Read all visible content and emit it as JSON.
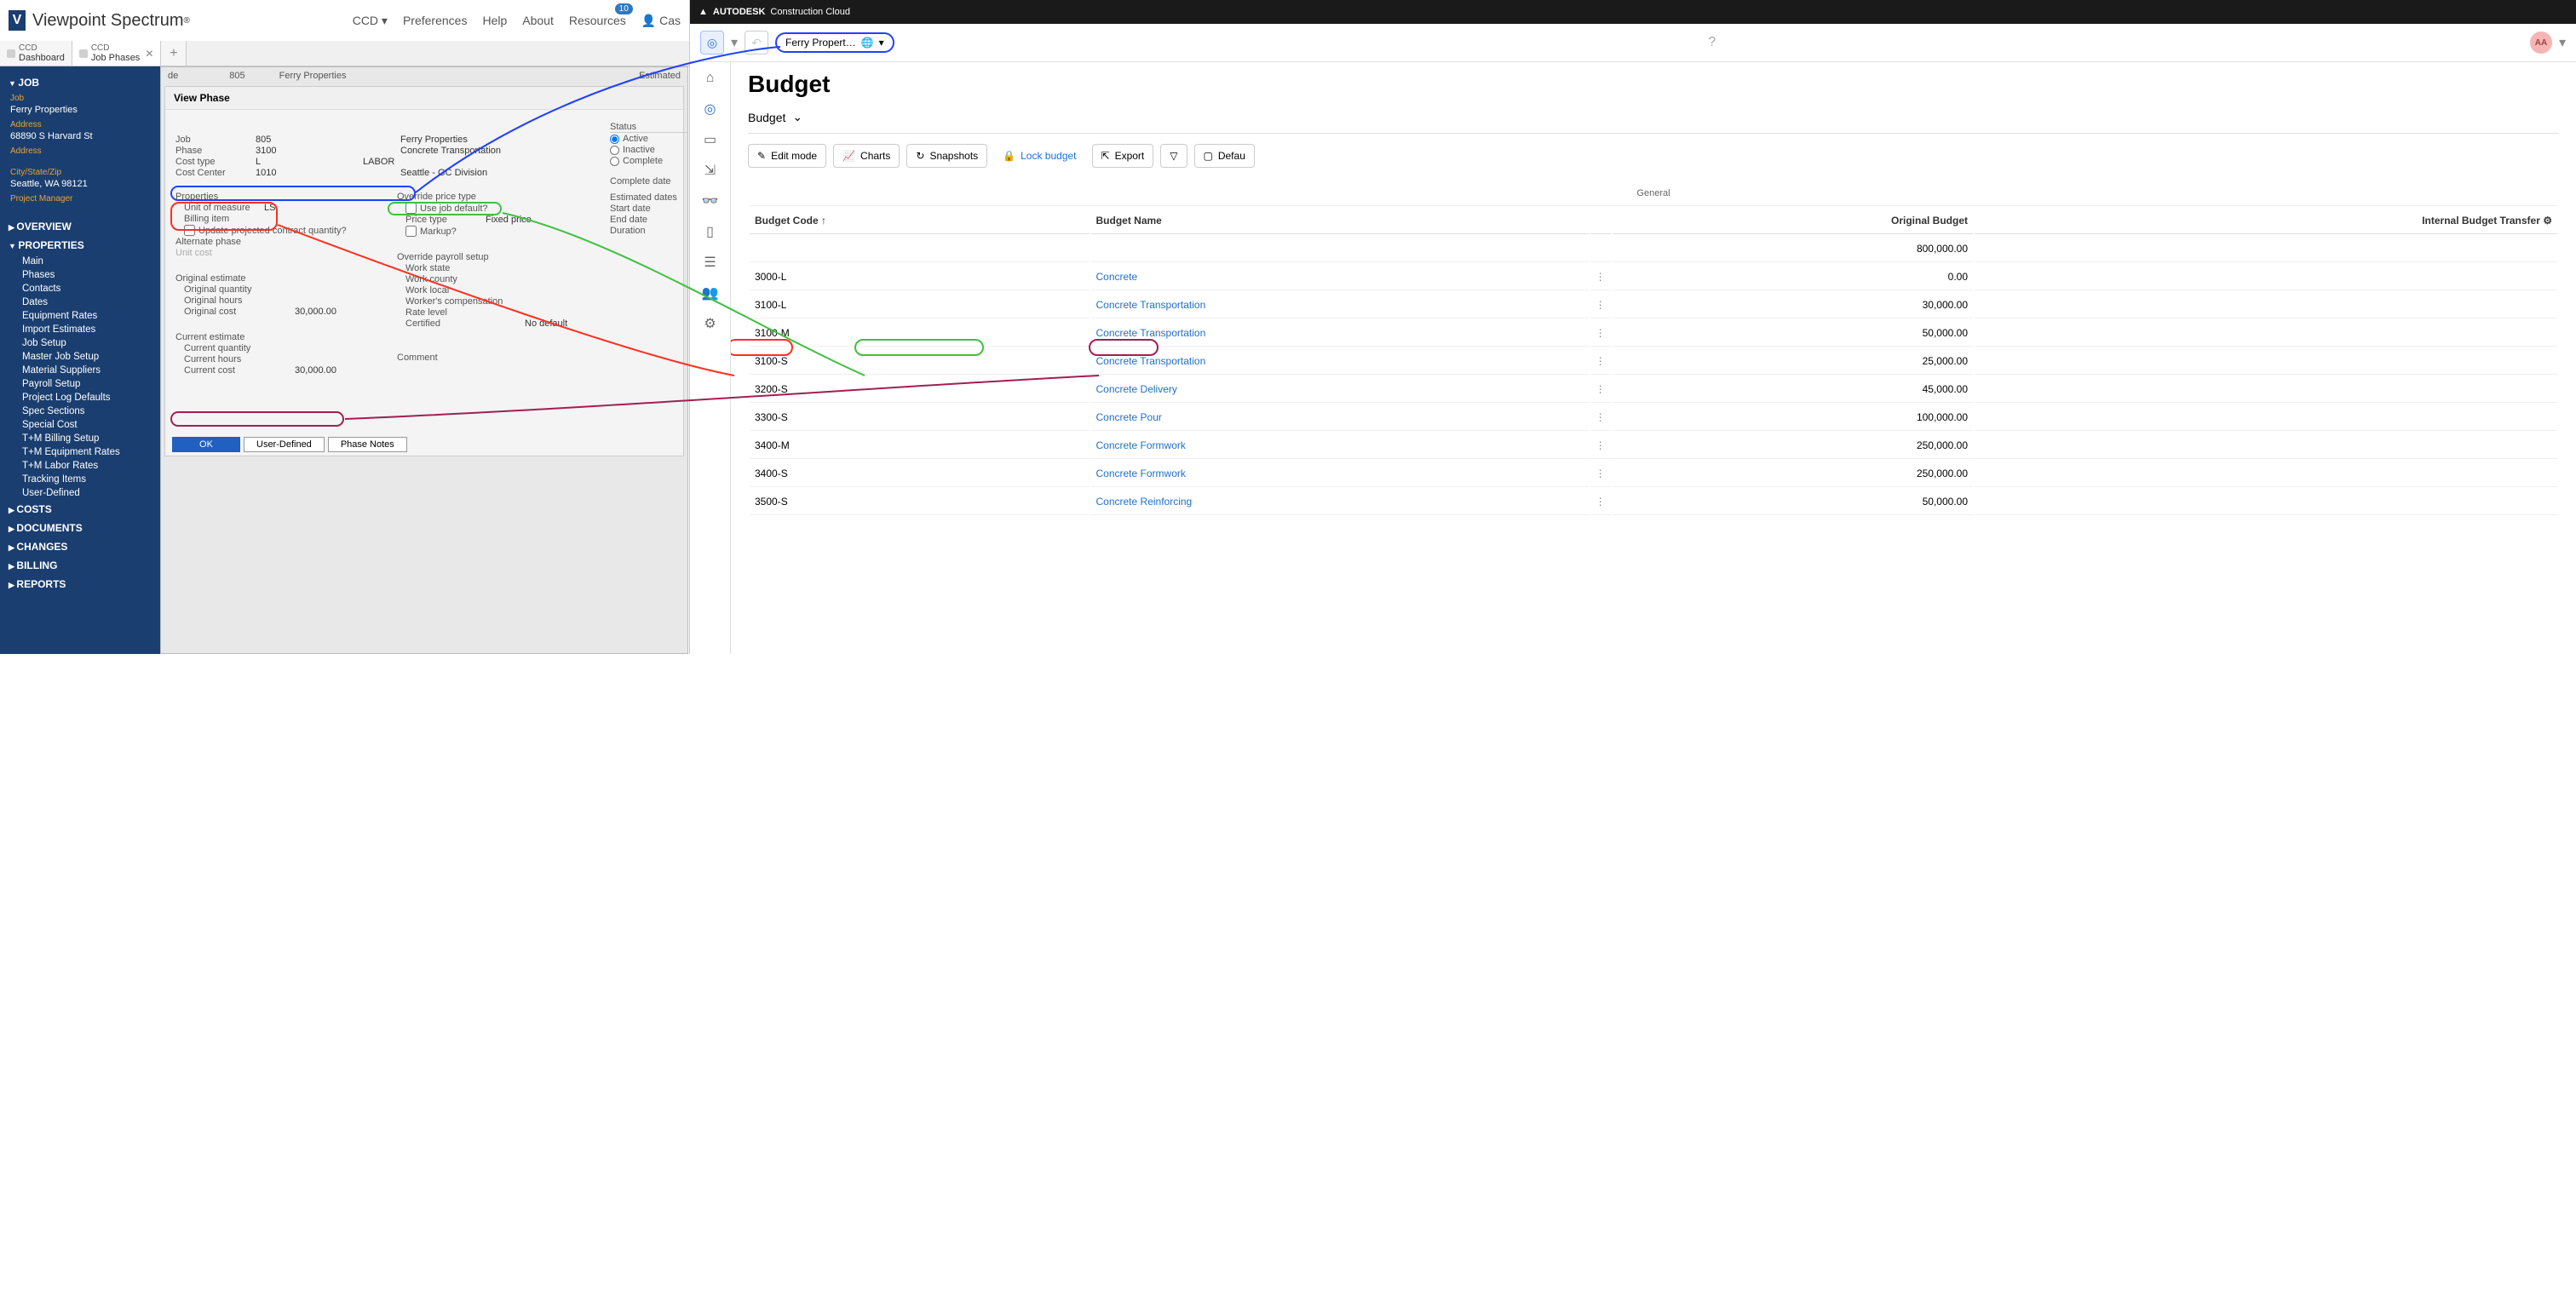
{
  "viewpoint": {
    "brand": "Viewpoint Spectrum",
    "topnav": {
      "ccd": "CCD",
      "preferences": "Preferences",
      "help": "Help",
      "about": "About",
      "resources": "Resources",
      "resources_badge": "10",
      "user": "Cas"
    },
    "tabs": [
      {
        "super": "CCD",
        "title": "Dashboard"
      },
      {
        "super": "CCD",
        "title": "Job Phases"
      }
    ],
    "sidebar": {
      "job_header": "JOB",
      "job_label": "Job",
      "job_value": "Ferry Properties",
      "addr_label": "Address",
      "addr_value": "68890 S Harvard St",
      "addr2_label": "Address",
      "city_label": "City/State/Zip",
      "city_value": "Seattle, WA 98121",
      "pm_label": "Project Manager",
      "sections": {
        "overview": "OVERVIEW",
        "properties": "PROPERTIES",
        "properties_items": [
          "Main",
          "Phases",
          "Contacts",
          "Dates",
          "Equipment Rates",
          "Import Estimates",
          "Job Setup",
          "Master Job Setup",
          "Material Suppliers",
          "Payroll Setup",
          "Project Log Defaults",
          "Spec Sections",
          "Special Cost",
          "T+M Billing Setup",
          "T+M Equipment Rates",
          "T+M Labor Rates",
          "Tracking Items",
          "User-Defined"
        ],
        "costs": "COSTS",
        "documents": "DOCUMENTS",
        "changes": "CHANGES",
        "billing": "BILLING",
        "reports": "REPORTS"
      }
    },
    "phase_panel": {
      "top_code_label": "de",
      "top_code": "805",
      "top_name": "Ferry Properties",
      "top_right": "Estimated",
      "title": "View Phase",
      "job_lbl": "Job",
      "job_code": "805",
      "job_name": "Ferry Properties",
      "phase_lbl": "Phase",
      "phase_code": "3100",
      "phase_name": "Concrete Transportation",
      "costtype_lbl": "Cost type",
      "costtype_code": "L",
      "costtype_name": "LABOR",
      "costcenter_lbl": "Cost Center",
      "costcenter_code": "1010",
      "costcenter_name": "Seattle - GC Division",
      "status_lbl": "Status",
      "status_active": "Active",
      "status_inactive": "Inactive",
      "status_complete": "Complete",
      "props_lbl": "Properties",
      "uom_lbl": "Unit of measure",
      "uom_val": "LS",
      "billing_lbl": "Billing item",
      "update_proj_lbl": "Update projected contract quantity?",
      "altphase_lbl": "Alternate phase",
      "unitcost_lbl": "Unit cost",
      "override_lbl": "Override price type",
      "usejob_lbl": "Use job default?",
      "pricetype_lbl": "Price type",
      "pricetype_val": "Fixed price",
      "markup_lbl": "Markup?",
      "payroll_lbl": "Override payroll setup",
      "workstate_lbl": "Work state",
      "workcounty_lbl": "Work county",
      "worklocal_lbl": "Work local",
      "wc_lbl": "Worker's compensation",
      "ratelevel_lbl": "Rate level",
      "certified_lbl": "Certified",
      "certified_val": "No default",
      "completedate_lbl": "Complete date",
      "estdates_lbl": "Estimated dates",
      "startdate_lbl": "Start date",
      "enddate_lbl": "End date",
      "duration_lbl": "Duration",
      "origest_lbl": "Original estimate",
      "origqty_lbl": "Original quantity",
      "orighrs_lbl": "Original hours",
      "origcost_lbl": "Original cost",
      "origcost_val": "30,000.00",
      "curest_lbl": "Current estimate",
      "curqty_lbl": "Current quantity",
      "curhrs_lbl": "Current hours",
      "curcost_lbl": "Current cost",
      "curcost_val": "30,000.00",
      "comment_lbl": "Comment",
      "ok_btn": "OK",
      "ud_btn": "User-Defined",
      "notes_btn": "Phase Notes"
    }
  },
  "acc": {
    "brand": "AUTODESK",
    "brand_sub": "Construction Cloud",
    "project": "Ferry Propert…",
    "avatar": "AA",
    "page_title": "Budget",
    "tab_label": "Budget",
    "toolbar": {
      "edit": "Edit mode",
      "charts": "Charts",
      "snapshots": "Snapshots",
      "lock": "Lock budget",
      "export": "Export",
      "default": "Defau"
    },
    "table": {
      "general": "General",
      "cols": {
        "code": "Budget Code",
        "name": "Budget Name",
        "orig": "Original Budget",
        "transfer": "Internal Budget Transfer"
      },
      "total_orig": "800,000.00",
      "rows": [
        {
          "code": "3000-L",
          "name": "Concrete",
          "orig": "0.00"
        },
        {
          "code": "3100-L",
          "name": "Concrete Transportation",
          "orig": "30,000.00"
        },
        {
          "code": "3100-M",
          "name": "Concrete Transportation",
          "orig": "50,000.00"
        },
        {
          "code": "3100-S",
          "name": "Concrete Transportation",
          "orig": "25,000.00"
        },
        {
          "code": "3200-S",
          "name": "Concrete Delivery",
          "orig": "45,000.00"
        },
        {
          "code": "3300-S",
          "name": "Concrete Pour",
          "orig": "100,000.00"
        },
        {
          "code": "3400-M",
          "name": "Concrete Formwork",
          "orig": "250,000.00"
        },
        {
          "code": "3400-S",
          "name": "Concrete Formwork",
          "orig": "250,000.00"
        },
        {
          "code": "3500-S",
          "name": "Concrete Reinforcing",
          "orig": "50,000.00"
        }
      ]
    }
  }
}
